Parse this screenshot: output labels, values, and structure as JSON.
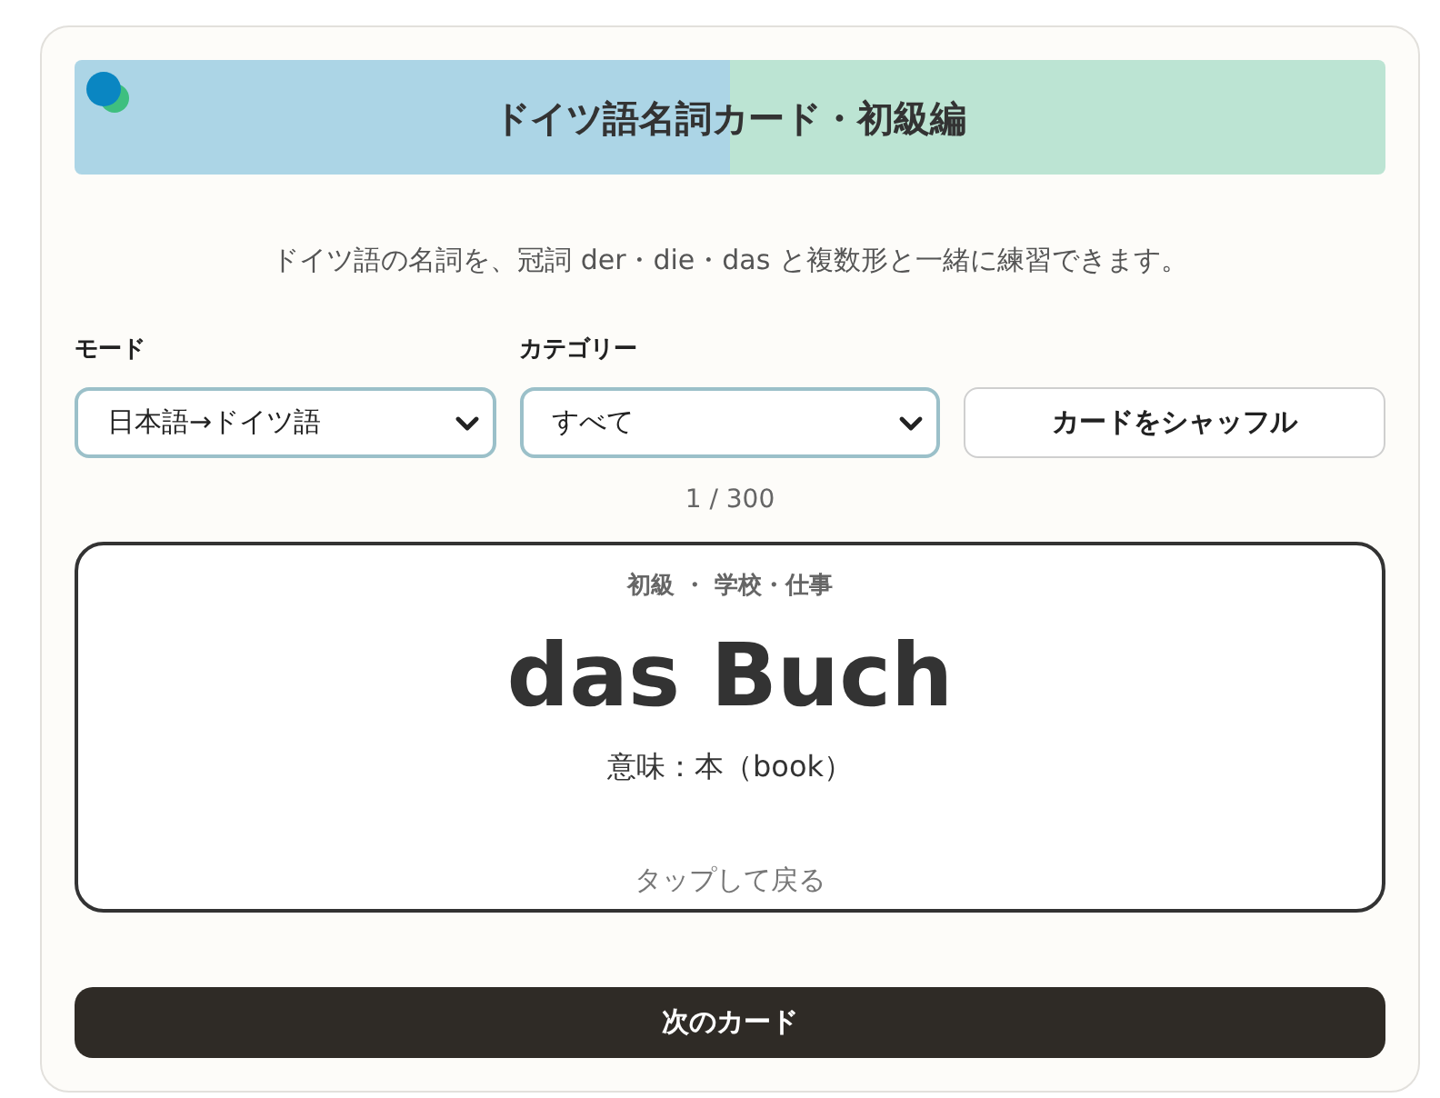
{
  "header": {
    "title": "ドイツ語名詞カード・初級編"
  },
  "description": "ドイツ語の名詞を、冠詞 der・die・das と複数形と一緒に練習できます。",
  "controls": [
    {
      "kind": "select",
      "label": "モード",
      "value": "日本語→ドイツ語"
    },
    {
      "kind": "select",
      "label": "カテゴリー",
      "value": "すべて"
    },
    {
      "kind": "button",
      "label": "カードをシャッフル"
    }
  ],
  "counter": "1 / 300",
  "card": {
    "meta": "初級 ・ 学校・仕事",
    "word": "das Buch",
    "meaning": "意味：本（book）",
    "hint": "タップして戻る"
  },
  "next_button": "次のカード"
}
